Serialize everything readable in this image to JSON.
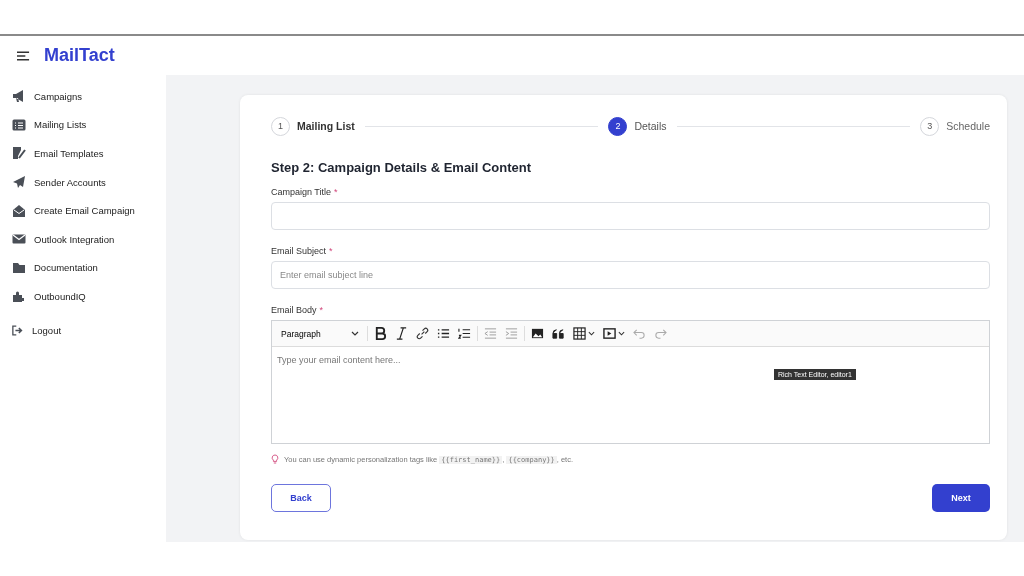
{
  "app": {
    "brand": "MailTact"
  },
  "sidebar": {
    "items": [
      {
        "label": "Campaigns"
      },
      {
        "label": "Mailing Lists"
      },
      {
        "label": "Email Templates"
      },
      {
        "label": "Sender Accounts"
      },
      {
        "label": "Create Email Campaign"
      },
      {
        "label": "Outlook Integration"
      },
      {
        "label": "Documentation"
      },
      {
        "label": "OutboundIQ"
      }
    ],
    "logout": "Logout"
  },
  "stepper": [
    {
      "number": "1",
      "label": "Mailing List",
      "selected": false
    },
    {
      "number": "2",
      "label": "Details",
      "selected": true
    },
    {
      "number": "3",
      "label": "Schedule",
      "selected": false
    }
  ],
  "form": {
    "heading": "Step 2: Campaign Details & Email Content",
    "fields": [
      {
        "label": "Campaign Title",
        "required_mark": "*"
      },
      {
        "label": "Email Subject",
        "required_mark": "*",
        "placeholder": "Enter email subject line"
      }
    ],
    "body": {
      "label": "Email Body",
      "required_mark": "*",
      "format": "Paragraph",
      "placeholder": "Type your email content here...",
      "tooltip": "Rich Text Editor, editor1"
    },
    "hint": [
      {
        "kind": "text",
        "text": "You can use dynamic personalization tags like "
      },
      {
        "kind": "code",
        "text": "{{first_name}}"
      },
      {
        "kind": "text",
        "text": ", "
      },
      {
        "kind": "code",
        "text": "{{company}}"
      },
      {
        "kind": "text",
        "text": ", etc."
      }
    ]
  },
  "buttons": {
    "back": "Back",
    "next": "Next"
  }
}
